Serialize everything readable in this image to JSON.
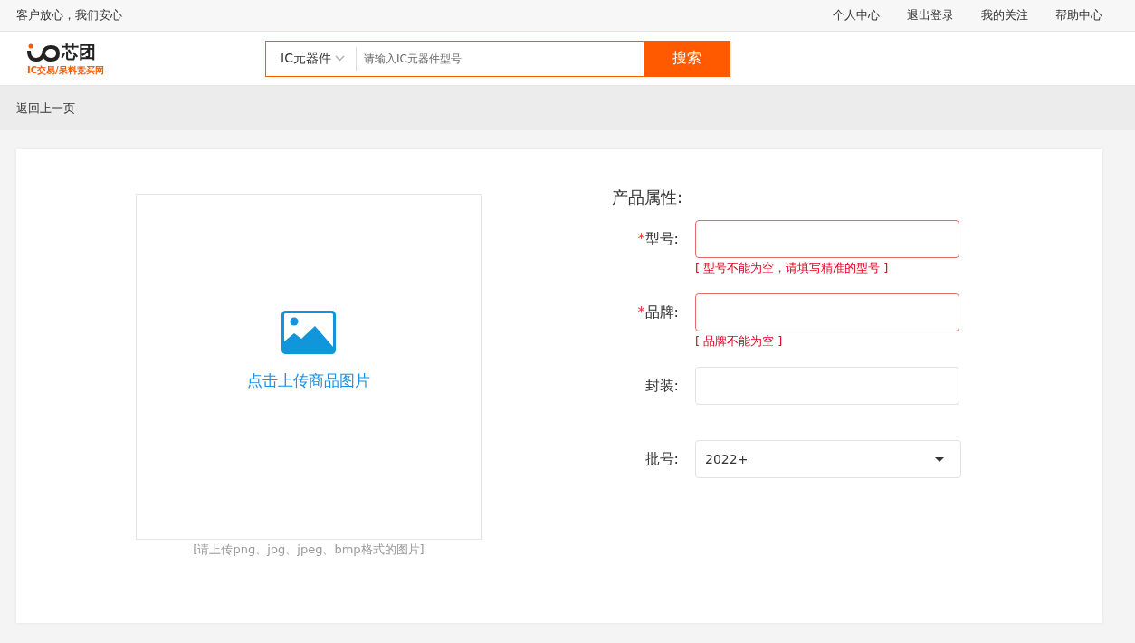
{
  "top_bar": {
    "slogan": "客户放心，我们安心",
    "links": [
      "个人中心",
      "退出登录",
      "我的关注",
      "帮助中心"
    ]
  },
  "header": {
    "logo": {
      "name": "芯团",
      "tagline": "IC交易/呆料竞买网"
    },
    "search": {
      "category": "IC元器件",
      "placeholder": "请输入IC元器件型号",
      "button": "搜索"
    }
  },
  "breadcrumb": {
    "back": "返回上一页"
  },
  "upload": {
    "label": "点击上传商品图片",
    "hint": "[请上传png、jpg、jpeg、bmp格式的图片]"
  },
  "form": {
    "title": "产品属性:",
    "fields": [
      {
        "kind": "text",
        "label": "型号:",
        "required_mark": "*",
        "error": "[ 型号不能为空，请填写精准的型号 ]"
      },
      {
        "kind": "text",
        "label": "品牌:",
        "required_mark": "*",
        "error": "[ 品牌不能为空 ]"
      },
      {
        "kind": "text",
        "label": "封装:"
      },
      {
        "kind": "select",
        "label": "批号:",
        "value": "2022+"
      }
    ]
  }
}
